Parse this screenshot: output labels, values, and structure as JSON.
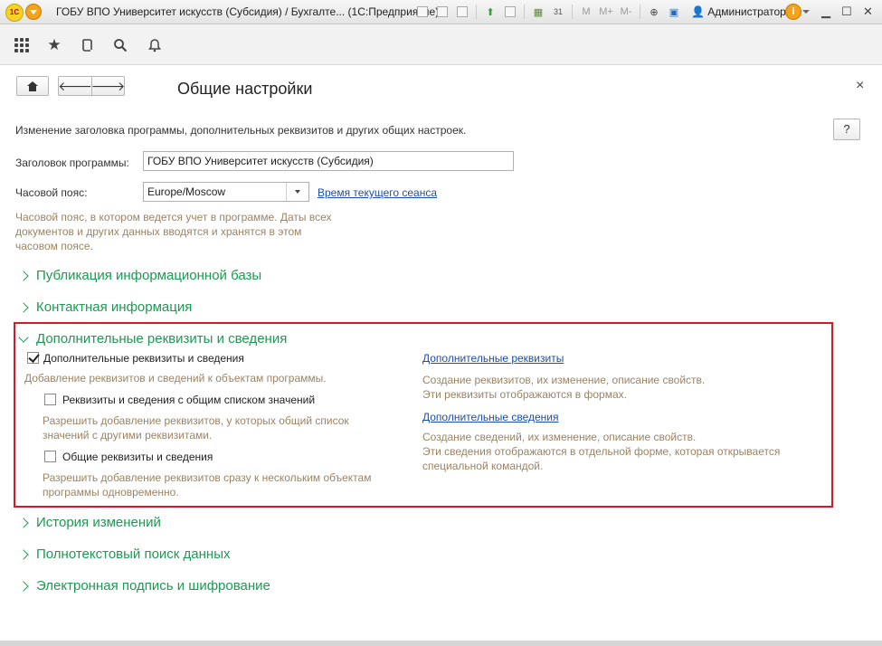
{
  "window": {
    "title": "ГОБУ ВПО Университет искусств (Субсидия) / Бухгалте... (1С:Предприятие)",
    "user": "Администратор"
  },
  "toolbar_icons": [
    "save-icon",
    "print-icon",
    "preview-icon",
    "attach-icon",
    "email-icon",
    "calculator-icon",
    "calendar-icon",
    "memory-m-icon",
    "memory-mplus-icon",
    "memory-mminus-icon",
    "zoom-icon",
    "panel-icon"
  ],
  "navbar": {
    "icons": [
      "apps-grid-icon",
      "favorites-star-icon",
      "history-icon",
      "search-icon",
      "bell-icon"
    ]
  },
  "form": {
    "title": "Общие настройки",
    "help_label": "?",
    "close_label": "×",
    "description": "Изменение заголовка программы, дополнительных реквизитов и других общих настроек.",
    "program_title_label": "Заголовок программы:",
    "program_title_value": "ГОБУ ВПО Университет искусств (Субсидия)",
    "timezone_label": "Часовой пояс:",
    "timezone_value": "Europe/Moscow",
    "session_time_link": "Время текущего сеанса",
    "timezone_hint_1": "Часовой пояс, в котором ведется учет в программе. Даты всех",
    "timezone_hint_2": "документов и других данных вводятся и хранятся в этом",
    "timezone_hint_3": "часовом поясе."
  },
  "sections": {
    "publication": "Публикация информационной базы",
    "contacts": "Контактная информация",
    "additional": "Дополнительные реквизиты и сведения",
    "history": "История изменений",
    "fulltext": "Полнотекстовый поиск данных",
    "esign": "Электронная подпись и шифрование"
  },
  "additional": {
    "cb_main_label": "Дополнительные реквизиты и сведения",
    "cb_main_checked": true,
    "cb_main_hint": "Добавление реквизитов и сведений к объектам программы.",
    "cb_common_list_label": "Реквизиты и сведения с общим списком значений",
    "cb_common_list_hint_1": "Разрешить добавление реквизитов, у которых общий список",
    "cb_common_list_hint_2": "значений с другими реквизитами.",
    "cb_common_label": "Общие реквизиты и сведения",
    "cb_common_hint_1": "Разрешить добавление реквизитов сразу к нескольким объектам",
    "cb_common_hint_2": "программы одновременно.",
    "link_attrs": "Дополнительные реквизиты",
    "link_attrs_hint_1": "Создание реквизитов, их изменение, описание свойств.",
    "link_attrs_hint_2": "Эти реквизиты отображаются в формах.",
    "link_info": "Дополнительные сведения",
    "link_info_hint_1": "Создание сведений, их изменение, описание свойств.",
    "link_info_hint_2": "Эти сведения отображаются в отдельной форме, которая открывается",
    "link_info_hint_3": "специальной командой."
  },
  "colors": {
    "section_green": "#1b9a52",
    "hint_brown": "#9a8464",
    "link_blue": "#1b4fa8",
    "highlight_red": "#d21a2a"
  }
}
